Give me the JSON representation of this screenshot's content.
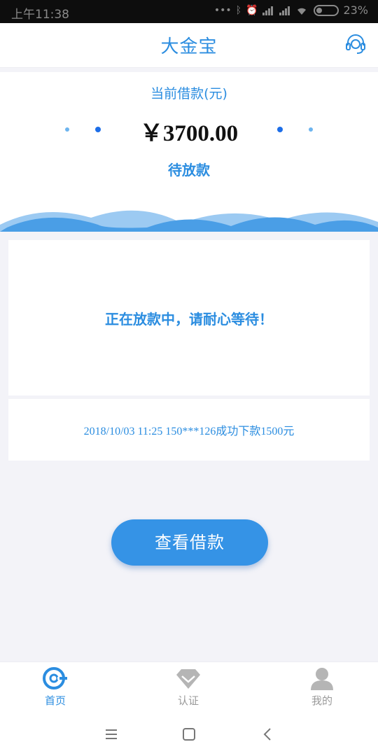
{
  "status_bar": {
    "time": "上午11:38",
    "battery": "23%"
  },
  "header": {
    "title": "大金宝"
  },
  "summary": {
    "label": "当前借款(元)",
    "amount": "￥3700.00",
    "status": "待放款"
  },
  "info": {
    "message": "正在放款中，请耐心等待！",
    "ticker": "2018/10/03 11:25 150***126成功下款1500元"
  },
  "cta": {
    "label": "查看借款"
  },
  "tabs": [
    {
      "label": "首页",
      "icon": "home-icon",
      "active": true
    },
    {
      "label": "认证",
      "icon": "diamond-icon",
      "active": false
    },
    {
      "label": "我的",
      "icon": "user-icon",
      "active": false
    }
  ],
  "colors": {
    "accent": "#2b8de0",
    "button": "#3593e6",
    "background": "#f3f3f8"
  }
}
